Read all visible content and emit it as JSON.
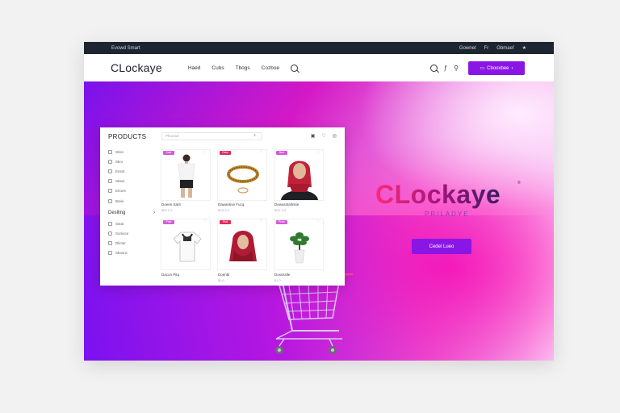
{
  "topbar": {
    "left": "Evowd Smart",
    "right_1": "Gownet",
    "right_2": "Fr",
    "right_3": "Gbmaef",
    "right_icon": "star-icon"
  },
  "navbar": {
    "brand": "CLockaye",
    "links": [
      "Haed",
      "Cubs",
      "Tbogs",
      "Cozboe"
    ],
    "icons": [
      "search-icon",
      "info-icon",
      "user-icon"
    ],
    "cta": "Cbooxbee"
  },
  "hero": {
    "title": "CLockaye",
    "tm": "®",
    "subtitle": "PRILADYE",
    "cta": "Cedel Lueo",
    "colors": {
      "accent": "#8a16e6",
      "pink": "#ff1fb6",
      "violet": "#7a12ec"
    }
  },
  "panel": {
    "title": "PRODUCTS",
    "search_placeholder": "Phoonar",
    "sidebar_top": [
      "Wiss",
      "Skor",
      "Erisst",
      "Stiser",
      "Eiroes",
      "Breis"
    ],
    "sidebar_heading": "Deslling",
    "sidebar_heading_chevron": "›",
    "sidebar_bottom": [
      "Sieat",
      "Somsce",
      "Dlicter",
      "Sbosnc"
    ],
    "cards": [
      {
        "badge": "Sole",
        "name": "Doeen Sarit",
        "price": "$Ek 0.4",
        "image": "tshirt-woman"
      },
      {
        "badge": "Dear",
        "name": "Dawantive Fucq",
        "price": "$EA 5.2",
        "image": "bracelet"
      },
      {
        "badge": "Nue",
        "name": "Dewasstalmkie",
        "price": "$Gk 3.9",
        "image": "hijab-woman"
      },
      {
        "badge": "Pole",
        "name": "Dacon Pitq",
        "price": "",
        "image": "tshirt"
      },
      {
        "badge": "Roll",
        "name": "Doenbl",
        "price": "$0.0",
        "image": "red-hijab"
      },
      {
        "badge": "Pnue",
        "name": "Dosssslle",
        "price": "$1.0",
        "image": "potted-plant"
      }
    ]
  }
}
